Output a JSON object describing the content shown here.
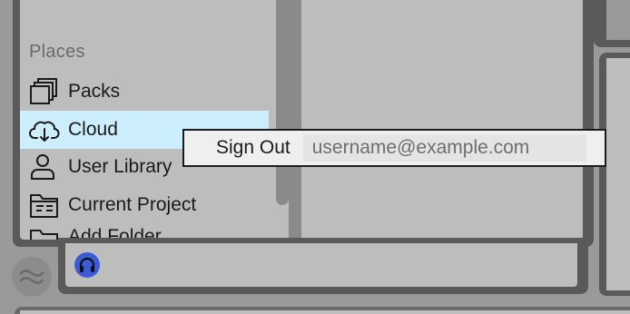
{
  "sidebar": {
    "section_title": "Places",
    "items": [
      {
        "label": "Packs",
        "icon": "packs-icon",
        "selected": false
      },
      {
        "label": "Cloud",
        "icon": "cloud-download-icon",
        "selected": true
      },
      {
        "label": "User Library",
        "icon": "user-icon",
        "selected": false
      },
      {
        "label": "Current Project",
        "icon": "project-folder-icon",
        "selected": false
      },
      {
        "label": "Add Folder...",
        "icon": "folder-icon",
        "selected": false
      }
    ]
  },
  "context_menu": {
    "sign_out_label": "Sign Out",
    "account_email": "username@example.com"
  },
  "bottom": {
    "waves_icon": "waves-icon",
    "headphone_icon": "headphones-icon"
  },
  "colors": {
    "selection": "#cdeefd",
    "panel": "#bdbdbd",
    "frame": "#5a5a5a",
    "headphone_button": "#3b5bd6"
  }
}
